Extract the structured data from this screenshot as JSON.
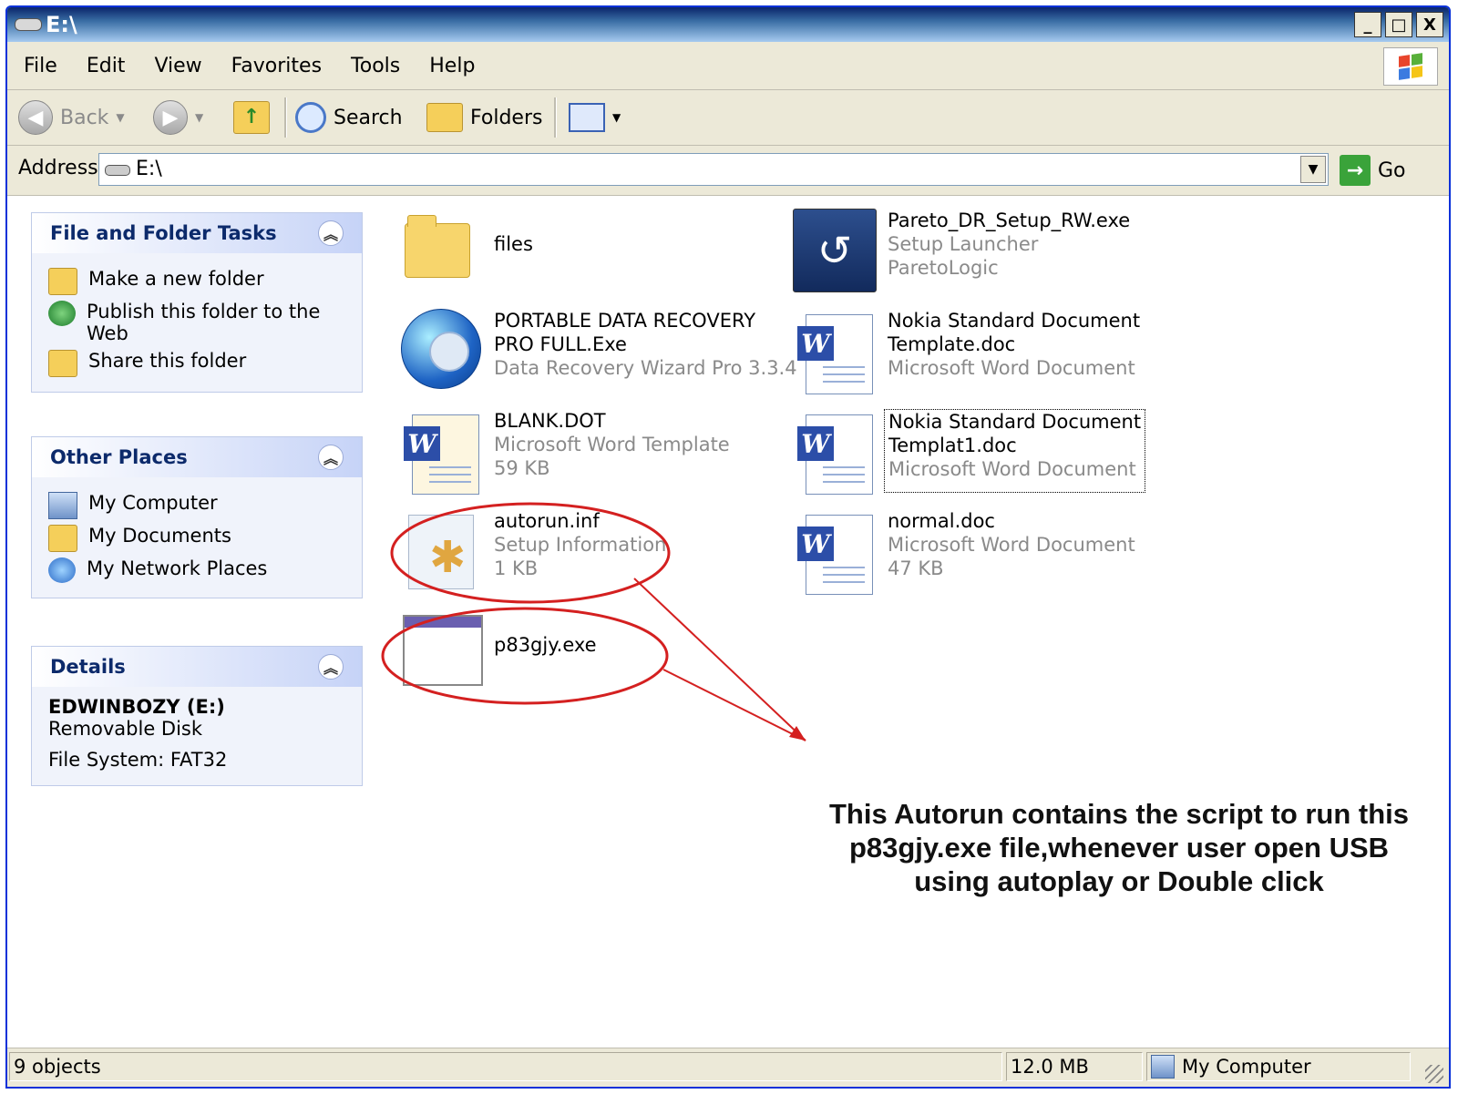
{
  "window": {
    "title": "E:\\",
    "min_label": "_",
    "max_label": "□",
    "close_label": "X"
  },
  "menu": {
    "items": [
      "File",
      "Edit",
      "View",
      "Favorites",
      "Tools",
      "Help"
    ]
  },
  "toolbar": {
    "back_label": "Back",
    "search_label": "Search",
    "folders_label": "Folders"
  },
  "address": {
    "label": "Address",
    "value": "E:\\",
    "go_label": "Go"
  },
  "sidebar": {
    "file_tasks": {
      "title": "File and Folder Tasks",
      "items": [
        {
          "label": "Make a new folder",
          "icon": "new-folder-icon"
        },
        {
          "label": "Publish this folder to the Web",
          "icon": "publish-web-icon"
        },
        {
          "label": "Share this folder",
          "icon": "share-folder-icon"
        }
      ]
    },
    "other_places": {
      "title": "Other Places",
      "items": [
        {
          "label": "My Computer",
          "icon": "my-computer-icon"
        },
        {
          "label": "My Documents",
          "icon": "my-documents-icon"
        },
        {
          "label": "My Network Places",
          "icon": "network-places-icon"
        }
      ]
    },
    "details": {
      "title": "Details",
      "drive_name": "EDWINBOZY (E:)",
      "drive_type": "Removable Disk",
      "file_system": "File System: FAT32"
    }
  },
  "files": [
    {
      "name": "files",
      "line2": "",
      "line3": "",
      "icon": "folder-icon"
    },
    {
      "name": "Pareto_DR_Setup_RW.exe",
      "line2": "Setup Launcher",
      "line3": "ParetoLogic",
      "icon": "setup-launcher-icon"
    },
    {
      "name": "PORTABLE DATA RECOVERY",
      "name2": "PRO FULL.Exe",
      "line3": "Data Recovery Wizard Pro 3.3.4",
      "icon": "ie-globe-icon"
    },
    {
      "name": "Nokia Standard Document",
      "name2": "Template.doc",
      "line3": "Microsoft Word Document",
      "icon": "word-document-icon"
    },
    {
      "name": "BLANK.DOT",
      "line2": "Microsoft Word Template",
      "line3": "59 KB",
      "icon": "word-template-icon"
    },
    {
      "name": "Nokia Standard Document",
      "name2": "Templat1.doc",
      "line3": "Microsoft Word Document",
      "icon": "word-document-icon"
    },
    {
      "name": "autorun.inf",
      "line2": "Setup Information",
      "line3": "1 KB",
      "icon": "setup-information-icon"
    },
    {
      "name": "normal.doc",
      "line2": "Microsoft Word Document",
      "line3": "47 KB",
      "icon": "word-document-icon"
    },
    {
      "name": "p83gjy.exe",
      "line2": "",
      "line3": "",
      "icon": "application-icon"
    }
  ],
  "annotation": {
    "line1": "This Autorun contains the script to run this",
    "line2": "p83gjy.exe file,whenever user open USB",
    "line3": "using autoplay or Double click",
    "color": "#d42020"
  },
  "status": {
    "objects": "9 objects",
    "size": "12.0 MB",
    "location": "My Computer"
  }
}
